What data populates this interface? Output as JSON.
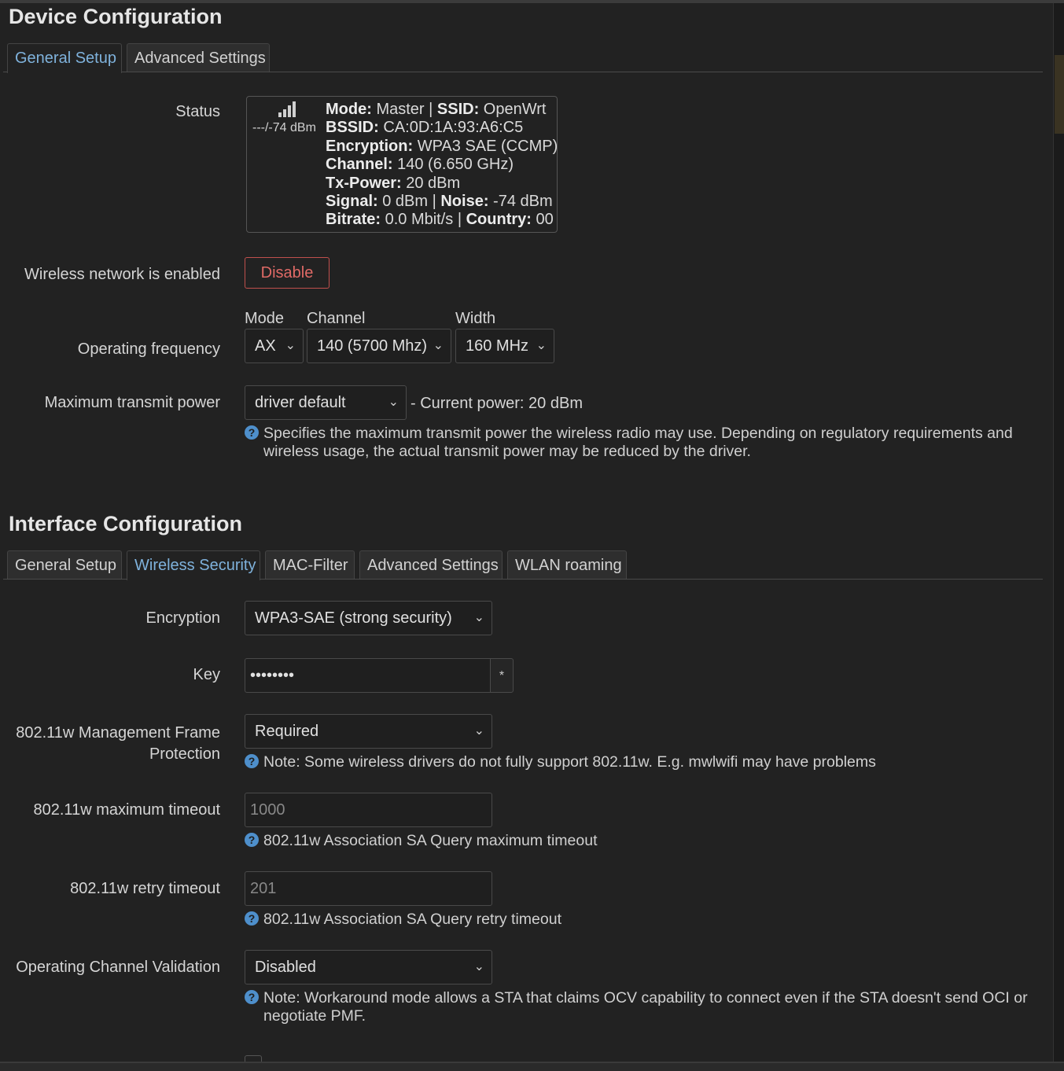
{
  "device": {
    "title": "Device Configuration",
    "tabs": [
      {
        "label": "General Setup",
        "active": true
      },
      {
        "label": "Advanced Settings",
        "active": false
      }
    ],
    "status": {
      "label": "Status",
      "signal_text": "---/-74 dBm",
      "lines": [
        {
          "k1": "Mode:",
          "v1": "Master | ",
          "k2": "SSID:",
          "v2": "OpenWrt"
        },
        {
          "k1": "BSSID:",
          "v1": "CA:0D:1A:93:A6:C5"
        },
        {
          "k1": "Encryption:",
          "v1": "WPA3 SAE (CCMP)"
        },
        {
          "k1": "Channel:",
          "v1": "140 (6.650 GHz)"
        },
        {
          "k1": "Tx-Power:",
          "v1": "20 dBm"
        },
        {
          "k1": "Signal:",
          "v1": "0 dBm | ",
          "k2": "Noise:",
          "v2": "-74 dBm"
        },
        {
          "k1": "Bitrate:",
          "v1": "0.0 Mbit/s | ",
          "k2": "Country:",
          "v2": "00"
        }
      ]
    },
    "wireless_enabled": {
      "label": "Wireless network is enabled",
      "button": "Disable"
    },
    "freq": {
      "label": "Operating frequency",
      "mode_label": "Mode",
      "mode_value": "AX",
      "channel_label": "Channel",
      "channel_value": "140 (5700 Mhz)",
      "width_label": "Width",
      "width_value": "160 MHz"
    },
    "txpower": {
      "label": "Maximum transmit power",
      "value": "driver default",
      "current": "- Current power: 20 dBm",
      "help": "Specifies the maximum transmit power the wireless radio may use. Depending on regulatory requirements and wireless usage, the actual transmit power may be reduced by the driver."
    }
  },
  "iface": {
    "title": "Interface Configuration",
    "tabs": [
      {
        "label": "General Setup",
        "active": false
      },
      {
        "label": "Wireless Security",
        "active": true
      },
      {
        "label": "MAC-Filter",
        "active": false
      },
      {
        "label": "Advanced Settings",
        "active": false
      },
      {
        "label": "WLAN roaming",
        "active": false
      }
    ],
    "encryption": {
      "label": "Encryption",
      "value": "WPA3-SAE (strong security)"
    },
    "key": {
      "label": "Key",
      "value": "••••••••",
      "reveal": "*"
    },
    "mfp": {
      "label_line1": "802.11w Management Frame",
      "label_line2": "Protection",
      "value": "Required",
      "help": "Note: Some wireless drivers do not fully support 802.11w. E.g. mwlwifi may have problems"
    },
    "max_timeout": {
      "label": "802.11w maximum timeout",
      "placeholder": "1000",
      "help": "802.11w Association SA Query maximum timeout"
    },
    "retry_timeout": {
      "label": "802.11w retry timeout",
      "placeholder": "201",
      "help": "802.11w Association SA Query retry timeout"
    },
    "ocv": {
      "label": "Operating Channel Validation",
      "value": "Disabled",
      "help": "Note: Workaround mode allows a STA that claims OCV capability to connect even if the STA doesn't send OCI or negotiate PMF."
    }
  },
  "colors": {
    "accent": "#7fb2dc",
    "danger": "#e06a66",
    "help_icon": "#4e8fcb",
    "background": "#222222"
  }
}
